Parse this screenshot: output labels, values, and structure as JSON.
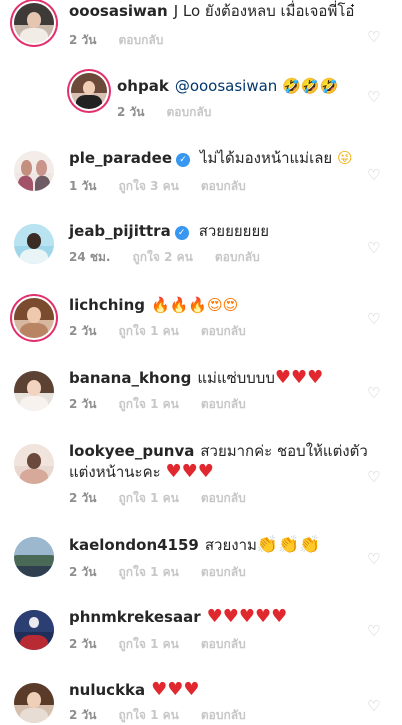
{
  "comments": [
    {
      "user": "ooosasiwan",
      "text": "J Lo ยังต้องหลบ เมื่อเจอพี่โอ๋",
      "time": "2 วัน",
      "reply": "ตอบกลับ"
    },
    {
      "user": "ohpak",
      "mention": "@ooosasiwan",
      "emoji": "🤣🤣🤣",
      "time": "2 วัน",
      "reply": "ตอบกลับ"
    },
    {
      "user": "ple_paradee",
      "text": "ไม่ได้มองหน้าแม่เลย",
      "emoji": "😜",
      "time": "1 วัน",
      "likes": "ถูกใจ 3 คน",
      "reply": "ตอบกลับ"
    },
    {
      "user": "jeab_pijittra",
      "text": "สวยยยยยย",
      "time": "24 ชม.",
      "likes": "ถูกใจ 2 คน",
      "reply": "ตอบกลับ"
    },
    {
      "user": "lichching",
      "emoji": "🔥🔥🔥😍😍",
      "time": "2 วัน",
      "likes": "ถูกใจ 1 คน",
      "reply": "ตอบกลับ"
    },
    {
      "user": "banana_khong",
      "text": "แม่แซ่บบบบ",
      "emoji": "♥♥♥",
      "time": "2 วัน",
      "likes": "ถูกใจ 1 คน",
      "reply": "ตอบกลับ"
    },
    {
      "user": "lookyee_punva",
      "text": "สวยมากค่ะ ชอบให้แต่งตัว",
      "text2": "แต่งหน้านะคะ",
      "emoji": "♥♥♥",
      "time": "2 วัน",
      "likes": "ถูกใจ 1 คน",
      "reply": "ตอบกลับ"
    },
    {
      "user": "kaelondon4159",
      "text": "สวยงาม",
      "emoji": "👏👏👏",
      "time": "2 วัน",
      "likes": "ถูกใจ 1 คน",
      "reply": "ตอบกลับ"
    },
    {
      "user": "phnmkrekesaar",
      "emoji": "♥♥♥♥♥",
      "time": "2 วัน",
      "likes": "ถูกใจ 1 คน",
      "reply": "ตอบกลับ"
    },
    {
      "user": "nuluckka",
      "emoji": "♥♥♥",
      "time": "2 วัน",
      "likes": "ถูกใจ 1 คน",
      "reply": "ตอบกลับ"
    }
  ],
  "colors": {
    "verified": "#3897f0",
    "heart": "#e0282e",
    "meta": "#8e8e8e"
  }
}
